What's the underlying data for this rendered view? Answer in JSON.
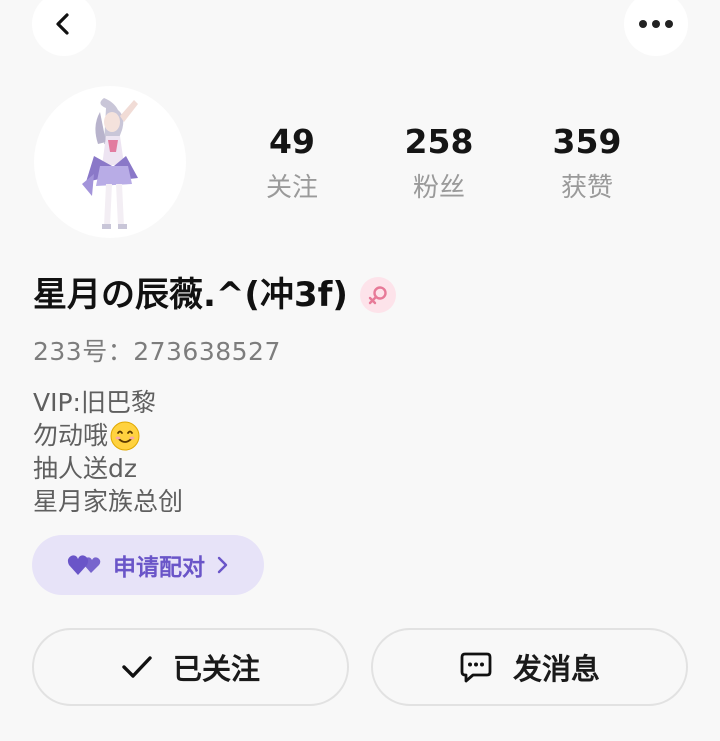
{
  "header": {
    "back_icon": "chevron-left-icon",
    "more_icon": "more-horizontal-icon"
  },
  "profile": {
    "avatar_icon": "anime-character-avatar",
    "stats": [
      {
        "value": "49",
        "label": "关注"
      },
      {
        "value": "258",
        "label": "粉丝"
      },
      {
        "value": "359",
        "label": "获赞"
      }
    ],
    "nickname": "星月の辰薇.^(冲3f)",
    "gender_icon": "female-icon",
    "gender_color": "#e77a98",
    "uid_label": "233号：",
    "uid_value": "273638527",
    "bio": [
      "VIP:旧巴黎",
      "勿动哦",
      "抽人送dz",
      "星月家族总创"
    ],
    "bio_emoji": "smiling-face-emoji"
  },
  "match_button": {
    "label": "申请配对",
    "icon": "hearts-icon",
    "color": "#6a55c8"
  },
  "actions": {
    "follow_label": "已关注",
    "message_label": "发消息"
  }
}
